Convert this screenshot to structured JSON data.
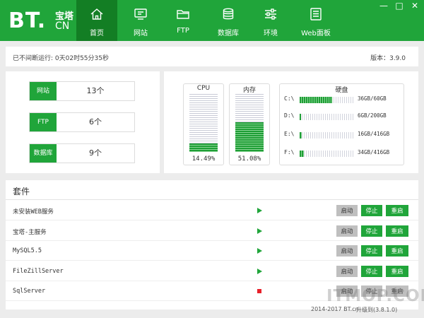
{
  "app": {
    "logo_text": "BT.",
    "logo_cn_name": "宝塔",
    "logo_cn_domain": "CN"
  },
  "window_controls": [
    "—",
    "□",
    "✕"
  ],
  "nav": [
    {
      "label": "首页",
      "icon": "home-icon",
      "active": true
    },
    {
      "label": "网站",
      "icon": "monitor-icon",
      "active": false
    },
    {
      "label": "FTP",
      "icon": "folder-icon",
      "active": false
    },
    {
      "label": "数据库",
      "icon": "database-icon",
      "active": false
    },
    {
      "label": "环境",
      "icon": "sliders-icon",
      "active": false
    },
    {
      "label": "Web面板",
      "icon": "list-icon",
      "active": false
    }
  ],
  "status": {
    "uptime": "已不间断运行: 0天02时55分35秒",
    "version": "版本：3.9.0"
  },
  "stats": [
    {
      "label": "网站",
      "value": "13个"
    },
    {
      "label": "FTP",
      "value": "6个"
    },
    {
      "label": "数据库",
      "value": "9个"
    }
  ],
  "monitor": {
    "cpu": {
      "title": "CPU",
      "value_text": "14.49%",
      "percent": 14.49
    },
    "mem": {
      "title": "内存",
      "value_text": "51.08%",
      "percent": 51.08
    },
    "disk": {
      "title": "硬盘",
      "drives": [
        {
          "label": "C:\\",
          "text": "36GB/60GB",
          "fraction": 0.6
        },
        {
          "label": "D:\\",
          "text": "6GB/200GB",
          "fraction": 0.03
        },
        {
          "label": "E:\\",
          "text": "16GB/416GB",
          "fraction": 0.038
        },
        {
          "label": "F:\\",
          "text": "34GB/416GB",
          "fraction": 0.082
        }
      ]
    }
  },
  "services": {
    "header": "套件",
    "buttons": {
      "start": "启动",
      "stop": "停止",
      "restart": "重启"
    },
    "items": [
      {
        "name": "未安装WEB服务",
        "state": "running"
      },
      {
        "name": "宝塔-主服务",
        "state": "running"
      },
      {
        "name": "MySQL5.5",
        "state": "running"
      },
      {
        "name": "FileZillServer",
        "state": "running"
      },
      {
        "name": "SqlServer",
        "state": "stopped"
      }
    ]
  },
  "footer": {
    "copyright": "2014-2017 BT.cn",
    "upgrade": "升级到(3.8.1.0)"
  },
  "watermark": "ITMOP.COM",
  "colors": {
    "brand": "#20a53a",
    "brand_dark": "#137e24",
    "running": "#20a53a",
    "stopped": "#e8202a"
  }
}
